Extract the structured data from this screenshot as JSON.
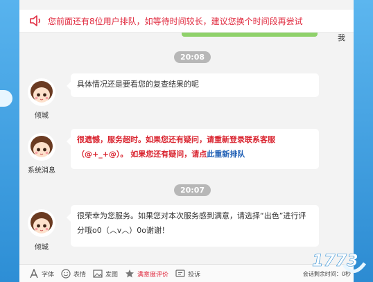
{
  "notice": {
    "text": "您前面还有8位用户排队，如等待时间较长，建议您换个时间段再尝试",
    "icon": "speaker-icon"
  },
  "me_label": "我",
  "messages": [
    {
      "time": "20:08",
      "sender": "倾城",
      "text": "具体情况还是要看您的复查结果的呢"
    },
    {
      "sender": "系统消息",
      "text_a": "很遗憾，服务超时。如果您还有疑问，请重新登录联系客服（@+_+@）。 如果您还有疑问，请点",
      "link": "此重新排队"
    },
    {
      "time": "20:07",
      "sender": "倾城",
      "text": "很荣幸为您服务。如果您对本次服务感到满意，请选择“出色”进行评分哦o0（︿v︿）0o谢谢！"
    }
  ],
  "toolbar": {
    "font": "字体",
    "emoji": "表情",
    "image": "发图",
    "rating": "满意度评价",
    "complaint": "投诉",
    "remaining": "会话剩余时间：0秒"
  },
  "colors": {
    "accent_red": "#e0293e",
    "link_blue": "#1f5fb5",
    "bubble": "#ffffff",
    "chat_bg": "#f3f3f3"
  }
}
